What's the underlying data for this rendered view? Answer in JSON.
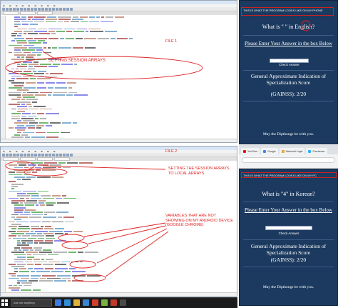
{
  "editor_1": {
    "annotation_file": "FILE 1",
    "annotation_arrays": "SETTING SESSION ARRAYS"
  },
  "editor_2": {
    "annotation_file": "FILE 2",
    "annotation_local": "SETTING THE SESSION ARRAYS TO LOCAL ARRAYS",
    "annotation_vars": "VARIABLES THAT ARE NOT SHOWING ON MY ANDROID DEVICE (GOOGLE CHROME)"
  },
  "phone_android": {
    "banner": "THIS IS WHAT THE PROGRAM LOOKS LIKE ON MY PHONE",
    "question": "What is \" \" in English?",
    "instructions": "Please Enter Your Answer in the box Below",
    "button": "Check Answer",
    "score_title": "General Approximate Indication of Specialization Score",
    "score_value": "(GAINSS): 2/20",
    "footer": "May the Dipthongs be with you."
  },
  "chrome": {
    "tabs": [
      {
        "label": "YouTube",
        "color": "#ff0000"
      },
      {
        "label": "Google",
        "color": "#4285f4"
      },
      {
        "label": "Webmail Login",
        "color": "#e8a33d"
      },
      {
        "label": "Freelancer",
        "color": "#29b2fe"
      }
    ]
  },
  "phone_pc": {
    "banner": "THIS IS WHAT THE PROGRAM LOOKS LIKE ON MY PC",
    "question": "What is \"4\" in Korean?",
    "instructions": "Please Enter Your Answer in the box Below",
    "button": "Check Answer",
    "score_title": "General Approximate Indication of Specialization Score",
    "score_value": "(GAINSS): 2/20",
    "footer": "May the Dipthongs be with you."
  },
  "taskbar": {
    "search_placeholder": "Ask me anything"
  },
  "colors": {
    "annotation": "#e02020",
    "phone_bg": "#1c3a5f",
    "taskbar": "#1b1b1b"
  }
}
